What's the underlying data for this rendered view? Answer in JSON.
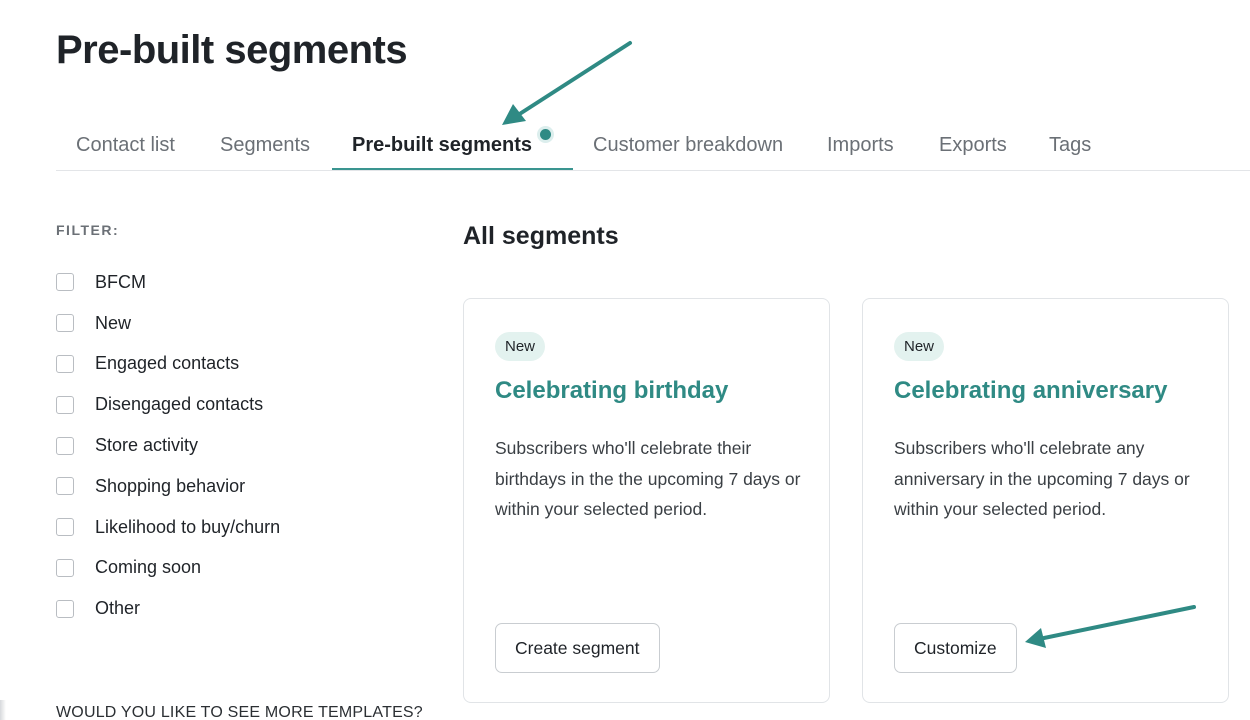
{
  "page": {
    "title": "Pre-built segments"
  },
  "tabs": [
    {
      "label": "Contact list",
      "active": false
    },
    {
      "label": "Segments",
      "active": false
    },
    {
      "label": "Pre-built segments",
      "active": true
    },
    {
      "label": "Customer breakdown",
      "active": false
    },
    {
      "label": "Imports",
      "active": false
    },
    {
      "label": "Exports",
      "active": false
    },
    {
      "label": "Tags",
      "active": false
    }
  ],
  "filter": {
    "heading": "FILTER:",
    "options": [
      {
        "label": "BFCM",
        "checked": false
      },
      {
        "label": "New",
        "checked": false
      },
      {
        "label": "Engaged contacts",
        "checked": false
      },
      {
        "label": "Disengaged contacts",
        "checked": false
      },
      {
        "label": "Store activity",
        "checked": false
      },
      {
        "label": "Shopping behavior",
        "checked": false
      },
      {
        "label": "Likelihood to buy/churn",
        "checked": false
      },
      {
        "label": "Coming soon",
        "checked": false
      },
      {
        "label": "Other",
        "checked": false
      }
    ],
    "more_templates": "WOULD YOU LIKE TO SEE MORE TEMPLATES?"
  },
  "segments": {
    "heading": "All segments",
    "cards": [
      {
        "badge": "New",
        "title": "Celebrating birthday",
        "description": "Subscribers who'll celebrate their birthdays in the the upcoming 7 days or within your selected period.",
        "button": "Create segment"
      },
      {
        "badge": "New",
        "title": "Celebrating anniversary",
        "description": "Subscribers who'll celebrate any anniversary in the upcoming 7 days or within your selected period.",
        "button": "Customize"
      }
    ]
  },
  "colors": {
    "accent": "#2f8a84",
    "badge_bg": "#e3f2ef",
    "annotation_arrow": "#2f8a84"
  }
}
